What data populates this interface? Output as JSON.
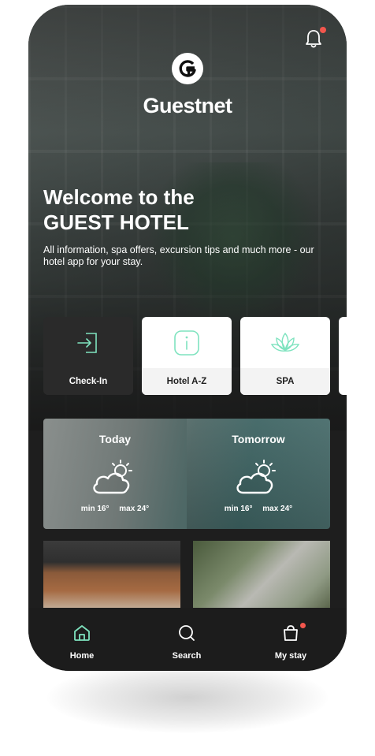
{
  "header": {
    "brand": "Guestnet"
  },
  "welcome": {
    "line1": "Welcome to the",
    "line2": "GUEST HOTEL",
    "subtitle": "All information, spa offers, excursion tips and much more - our hotel app for your stay."
  },
  "tiles": [
    {
      "label": "Check-In",
      "icon": "login-icon"
    },
    {
      "label": "Hotel A-Z",
      "icon": "info-icon"
    },
    {
      "label": "SPA",
      "icon": "lotus-icon"
    }
  ],
  "weather": {
    "today": {
      "label": "Today",
      "min": "min 16°",
      "max": "max 24°",
      "icon": "partly-cloudy-icon"
    },
    "tomorrow": {
      "label": "Tomorrow",
      "min": "min 16°",
      "max": "max 24°",
      "icon": "partly-cloudy-icon"
    }
  },
  "nav": {
    "items": [
      {
        "label": "Home",
        "icon": "home-icon",
        "active": true
      },
      {
        "label": "Search",
        "icon": "search-icon"
      },
      {
        "label": "My stay",
        "icon": "bag-icon",
        "badge": true
      }
    ]
  },
  "colors": {
    "accent": "#7fe3bf",
    "notification": "#f2564d"
  }
}
